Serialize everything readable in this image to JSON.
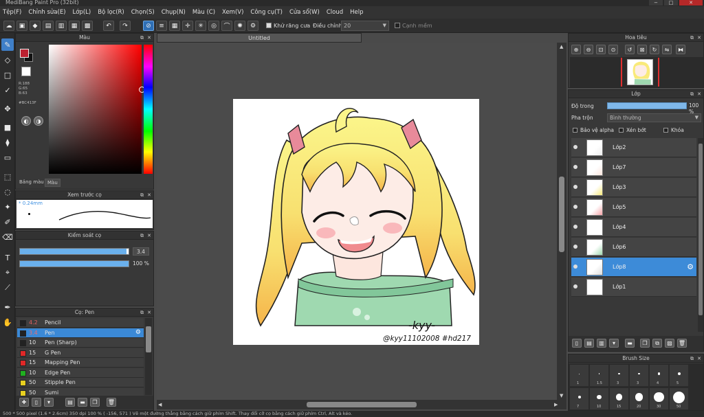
{
  "window": {
    "title": "MediBang Paint Pro (32bit)",
    "min": "−",
    "max": "□",
    "close": "✕"
  },
  "menu": [
    "Tệp(F)",
    "Chỉnh sửa(E)",
    "Lớp(L)",
    "Bộ lọc(R)",
    "Chọn(S)",
    "Chụp(N)",
    "Màu (C)",
    "Xem(V)",
    "Công cụ(T)",
    "Cửa sổ(W)",
    "Cloud",
    "Help"
  ],
  "toolbar": {
    "antialias_label": "Khử răng cưa",
    "adjust_label": "Điều chỉnh",
    "adjust_value": "20",
    "snap_label": "Cạnh mềm"
  },
  "color_panel": {
    "title": "Màu",
    "r": "R:188",
    "g": "G:65",
    "b": "B:63",
    "hex": "#BC413F",
    "tab_palette": "Bảng màu",
    "tab_color": "Màu",
    "fg_color": "#bc2030"
  },
  "preview_panel": {
    "title": "Xem trước cọ",
    "size": "* 0.24mm"
  },
  "control_panel": {
    "title": "Kiểm soát cọ",
    "size_value": "3.4",
    "size_fraction": 0.98,
    "opacity_value": "100 %",
    "opacity_fraction": 1.0
  },
  "brush_panel": {
    "title": "Cọ: Pen",
    "brushes": [
      {
        "size": "4.2",
        "name": "Pencil",
        "color": "#222222",
        "selected": false,
        "size_color": "#e06060"
      },
      {
        "size": "3.4",
        "name": "Pen",
        "color": "#222222",
        "selected": true,
        "size_color": "#e87070"
      },
      {
        "size": "10",
        "name": "Pen (Sharp)",
        "color": "#222222",
        "selected": false,
        "size_color": "#e0e0e0"
      },
      {
        "size": "15",
        "name": "G Pen",
        "color": "#e02828",
        "selected": false,
        "size_color": "#e0e0e0"
      },
      {
        "size": "15",
        "name": "Mapping Pen",
        "color": "#e02828",
        "selected": false,
        "size_color": "#e0e0e0"
      },
      {
        "size": "10",
        "name": "Edge Pen",
        "color": "#20b020",
        "selected": false,
        "size_color": "#e0e0e0"
      },
      {
        "size": "50",
        "name": "Stipple Pen",
        "color": "#e8d020",
        "selected": false,
        "size_color": "#e0e0e0"
      },
      {
        "size": "50",
        "name": "Sumi",
        "color": "#e8d020",
        "selected": false,
        "size_color": "#e0e0e0"
      }
    ]
  },
  "canvas": {
    "tab": "Untitled",
    "signature": "-kyy-",
    "handle": "@kyy11102008 #hd217"
  },
  "navigator": {
    "title": "Hoa tiêu"
  },
  "layer_panel": {
    "title": "Lớp",
    "opacity_label": "Độ trong",
    "opacity_value": "100 %",
    "opacity_fraction": 1.0,
    "blend_label": "Pha trộn",
    "blend_value": "Bình thường",
    "protect_alpha": "Bảo vệ alpha",
    "clipping": "Xén bớt",
    "lock": "Khóa",
    "layers": [
      {
        "name": "Lớp2",
        "selected": false
      },
      {
        "name": "Lớp7",
        "selected": false
      },
      {
        "name": "Lớp3",
        "selected": false
      },
      {
        "name": "Lớp5",
        "selected": false
      },
      {
        "name": "Lớp4",
        "selected": false
      },
      {
        "name": "Lớp6",
        "selected": false
      },
      {
        "name": "Lớp8",
        "selected": true
      },
      {
        "name": "Lớp1",
        "selected": false
      }
    ]
  },
  "brush_size_panel": {
    "title": "Brush Size",
    "row1": [
      "1",
      "1.5",
      "3",
      "3",
      "4",
      "5"
    ],
    "row2": [
      "7",
      "10",
      "15",
      "20",
      "30",
      "50"
    ]
  },
  "status": "500 * 500 pixel  (1.6 * 2.6cm)  350 dpi  100 %  ( -156, 571 )  Vẽ một đường thẳng bằng cách giữ phím Shift. Thay đổi cỡ cọ bằng cách giữ phím Ctrl, Alt và kéo.",
  "colors": {
    "accent": "#3b89d6",
    "panel": "#383838",
    "canvas_bg": "#4b4b4b"
  }
}
